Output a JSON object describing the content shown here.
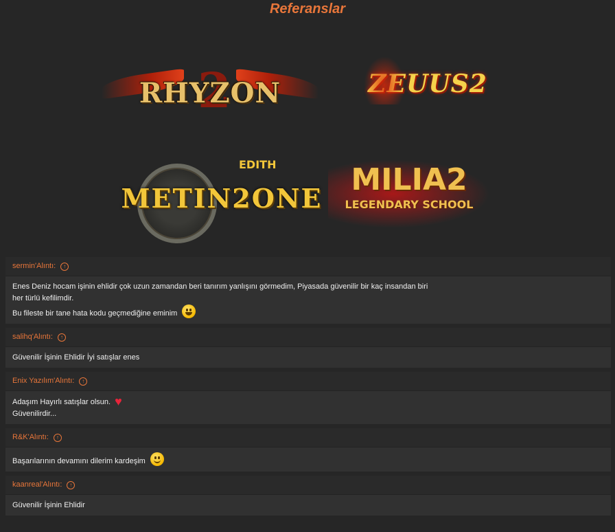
{
  "page": {
    "title": "Referanslar"
  },
  "logos": {
    "rhyzon": {
      "text": "RHYZON",
      "badge": "2"
    },
    "zeuus": {
      "text": "ZEUUS2"
    },
    "metinzone": {
      "text": "METIN2ONE",
      "small": "EDITH"
    },
    "milia": {
      "text": "MILIA2",
      "sub": "LEGENDARY SCHOOL"
    }
  },
  "quotes": [
    {
      "author": "sermin'Alıntı:",
      "lines": [
        "Enes Deniz hocam işinin ehlidir çok uzun zamandan beri tanırım yanlışını görmedim, Piyasada güvenilir bir kaç insandan biri",
        "her türlü kefilimdir.",
        "Bu fileste bir tane hata kodu geçmediğine eminim"
      ],
      "emoji": "grin-emoji"
    },
    {
      "author": "salihq'Alıntı:",
      "lines": [
        "Güvenilir İşinin Ehlidir İyi satışlar enes"
      ]
    },
    {
      "author": "Enix Yazılım'Alıntı:",
      "lines": [
        "Adaşım Hayırlı satışlar olsun.",
        "Güvenilirdir..."
      ],
      "emoji": "heart-emoji"
    },
    {
      "author": "R&K'Alıntı:",
      "lines": [
        "Başarılarının devamını dilerim kardeşim"
      ],
      "emoji": "smile-emoji"
    },
    {
      "author": "kaanreal'Alıntı:",
      "lines": [
        "Güvenilir İşinin Ehlidir"
      ]
    }
  ],
  "colors": {
    "accent": "#e8763a",
    "background": "#262626",
    "quote_bg": "#313131"
  }
}
